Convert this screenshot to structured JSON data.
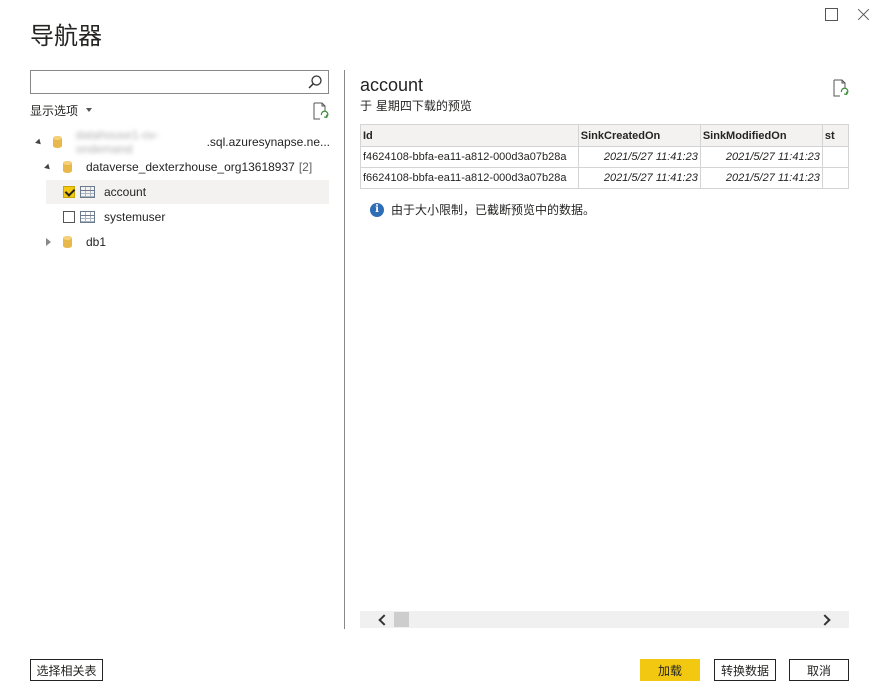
{
  "window": {
    "title": "导航器"
  },
  "search": {
    "value": "",
    "placeholder": ""
  },
  "display_options": {
    "label": "显示选项"
  },
  "tree": {
    "server": {
      "name_blurred": "datahouse1-ov-ondemand",
      "name_suffix": ".sql.azuresynapse.ne..."
    },
    "database": {
      "name": "dataverse_dexterzhouse_org13618937",
      "count": "[2]"
    },
    "tables": [
      {
        "label": "account",
        "checked": true
      },
      {
        "label": "systemuser",
        "checked": false
      }
    ],
    "other_db": {
      "name": "db1"
    }
  },
  "preview": {
    "title": "account",
    "subtitle": "于 星期四下载的预览",
    "columns": [
      "Id",
      "SinkCreatedOn",
      "SinkModifiedOn",
      "st"
    ],
    "rows": [
      [
        "f4624108-bbfa-ea11-a812-000d3a07b28a",
        "2021/5/27 11:41:23",
        "2021/5/27 11:41:23",
        ""
      ],
      [
        "f6624108-bbfa-ea11-a812-000d3a07b28a",
        "2021/5/27 11:41:23",
        "2021/5/27 11:41:23",
        ""
      ]
    ],
    "info_message": "由于大小限制，已截断预览中的数据。"
  },
  "buttons": {
    "select_related": "选择相关表",
    "load": "加载",
    "transform": "转换数据",
    "cancel": "取消"
  },
  "colors": {
    "accent": "#f2c811",
    "info": "#2f6db5",
    "database": "#e8b84a"
  },
  "icons": [
    "maximize-icon",
    "close-icon",
    "search-icon",
    "refresh-icon",
    "database-icon",
    "table-icon",
    "info-icon"
  ]
}
